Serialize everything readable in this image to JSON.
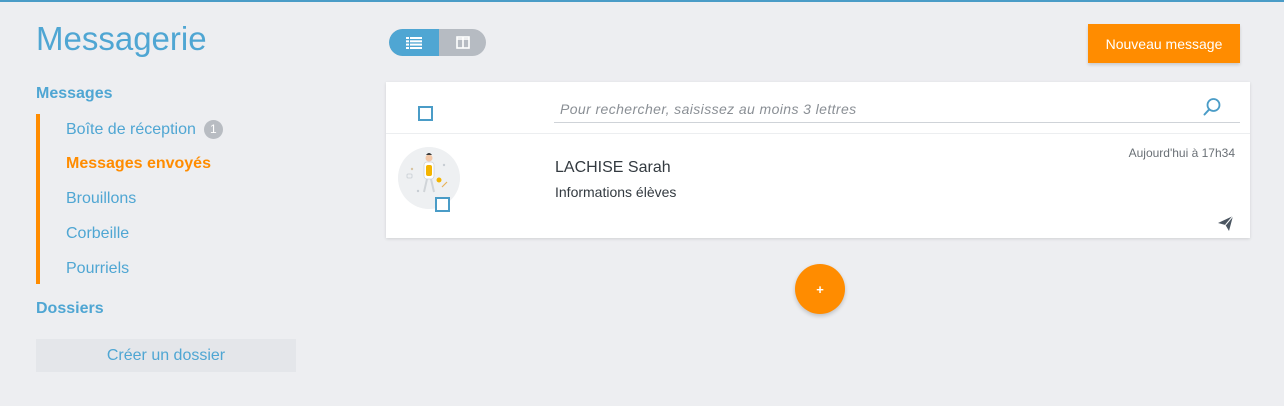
{
  "colors": {
    "accent": "#4fa6d3",
    "brand_orange": "#ff8c00",
    "background": "#edeef1"
  },
  "sidebar": {
    "title": "Messagerie",
    "messages_heading": "Messages",
    "items": [
      {
        "label": "Boîte de réception",
        "badge": "1"
      },
      {
        "label": "Messages envoyés",
        "active": true
      },
      {
        "label": "Brouillons"
      },
      {
        "label": "Corbeille"
      },
      {
        "label": "Pourriels"
      }
    ],
    "folders_heading": "Dossiers",
    "create_folder_label": "Créer un dossier"
  },
  "toolbar": {
    "view_modes": [
      {
        "name": "list-view",
        "icon": "list-icon",
        "selected": true
      },
      {
        "name": "split-view",
        "icon": "columns-icon",
        "selected": false
      }
    ],
    "new_message_label": "Nouveau message"
  },
  "search": {
    "placeholder": "Pour rechercher, saisissez au moins 3 lettres",
    "icon": "search-icon"
  },
  "messages": [
    {
      "sender": "LACHISE Sarah",
      "subject": "Informations élèves",
      "date": "Aujourd'hui à 17h34",
      "status_icon": "paper-plane-icon"
    }
  ],
  "fab_label": "+"
}
